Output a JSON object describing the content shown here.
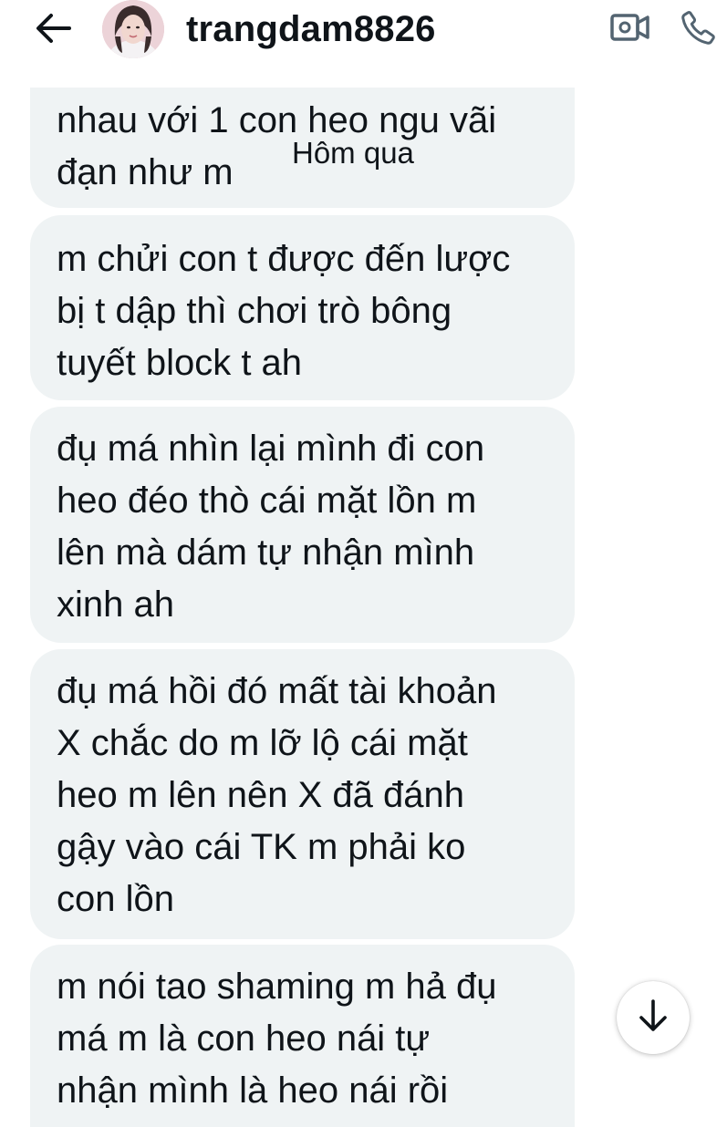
{
  "header": {
    "username": "trangdam8826",
    "icons": {
      "back": "arrow-left-icon",
      "video": "video-call-icon",
      "call": "phone-icon",
      "scroll": "arrow-down-icon"
    }
  },
  "date_separator": "Hôm qua",
  "messages": [
    {
      "text": "nhau với 1 con heo ngu vãi\nđạn như m"
    },
    {
      "text": "m chửi con t  được đến lược\nbị t dập thì  chơi trò bông\ntuyết block t ah"
    },
    {
      "text": "đụ má nhìn lại mình đi con\nheo đéo thò cái mặt lồn m\nlên mà dám tự nhận mình\nxinh ah"
    },
    {
      "text": "đụ má hồi đó mất tài khoản\nX chắc do m lỡ lộ cái mặt\nheo m lên nên X đã đánh\ngậy vào cái TK m phải ko\ncon lồn"
    },
    {
      "text": "m nói tao shaming m hả đụ\nmá m là con heo nái tự\nnhận mình là heo nái rồi"
    }
  ],
  "colors": {
    "bubble_bg": "#eff3f4",
    "text": "#0f1419",
    "icon_gray": "#536471"
  }
}
